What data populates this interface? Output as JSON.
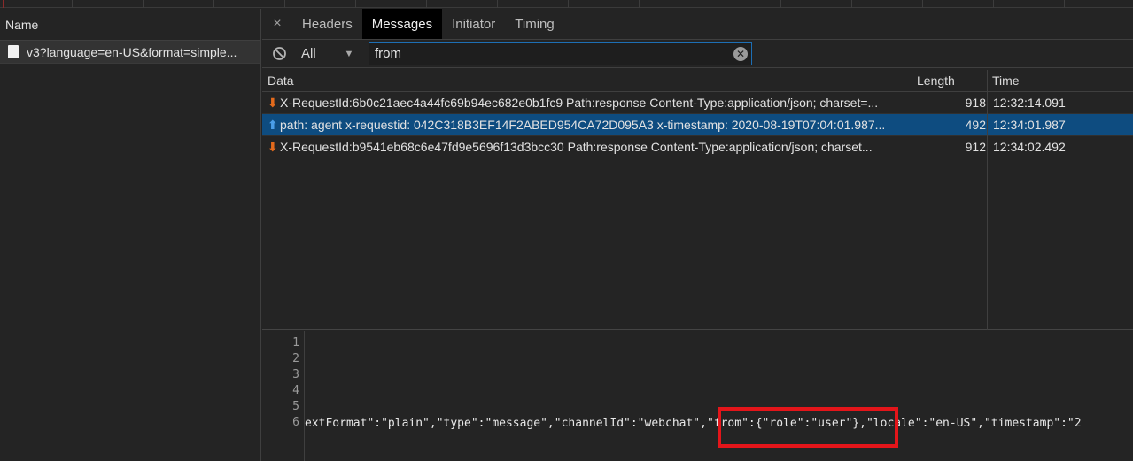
{
  "left_panel": {
    "header": "Name",
    "request_name": "v3?language=en-US&format=simple..."
  },
  "tabs": {
    "close": "×",
    "items": [
      "Headers",
      "Messages",
      "Initiator",
      "Timing"
    ],
    "active": "Messages"
  },
  "filter": {
    "type_label": "All",
    "dropdown_arrow": "▼",
    "search_value": "from",
    "clear_icon": "✕"
  },
  "grid": {
    "columns": [
      "Data",
      "Length",
      "Time"
    ],
    "rows": [
      {
        "direction": "down",
        "arrow": "⬇",
        "data": "X-RequestId:6b0c21aec4a44fc69b94ec682e0b1fc9 Path:response Content-Type:application/json; charset=...",
        "length": "918",
        "time": "12:32:14.091",
        "selected": false
      },
      {
        "direction": "up",
        "arrow": "⬆",
        "data": "path: agent x-requestid: 042C318B3EF14F2ABED954CA72D095A3 x-timestamp: 2020-08-19T07:04:01.987...",
        "length": "492",
        "time": "12:34:01.987",
        "selected": true
      },
      {
        "direction": "down",
        "arrow": "⬇",
        "data": "X-RequestId:b9541eb68c6e47fd9e5696f13d3bcc30 Path:response Content-Type:application/json; charset...",
        "length": "912",
        "time": "12:34:02.492",
        "selected": false
      }
    ]
  },
  "detail": {
    "line_numbers": [
      "1",
      "2",
      "3",
      "4",
      "5",
      "6"
    ],
    "line6": "extFormat\":\"plain\",\"type\":\"message\",\"channelId\":\"webchat\",\"from\":{\"role\":\"user\"},\"locale\":\"en-US\",\"timestamp\":\"2"
  },
  "colors": {
    "selected_row": "#0e4c80",
    "highlight_box": "#e3151a",
    "search_border": "#1d6fb5",
    "incoming_arrow": "#e36a1c",
    "outgoing_arrow": "#4a9ee8"
  }
}
